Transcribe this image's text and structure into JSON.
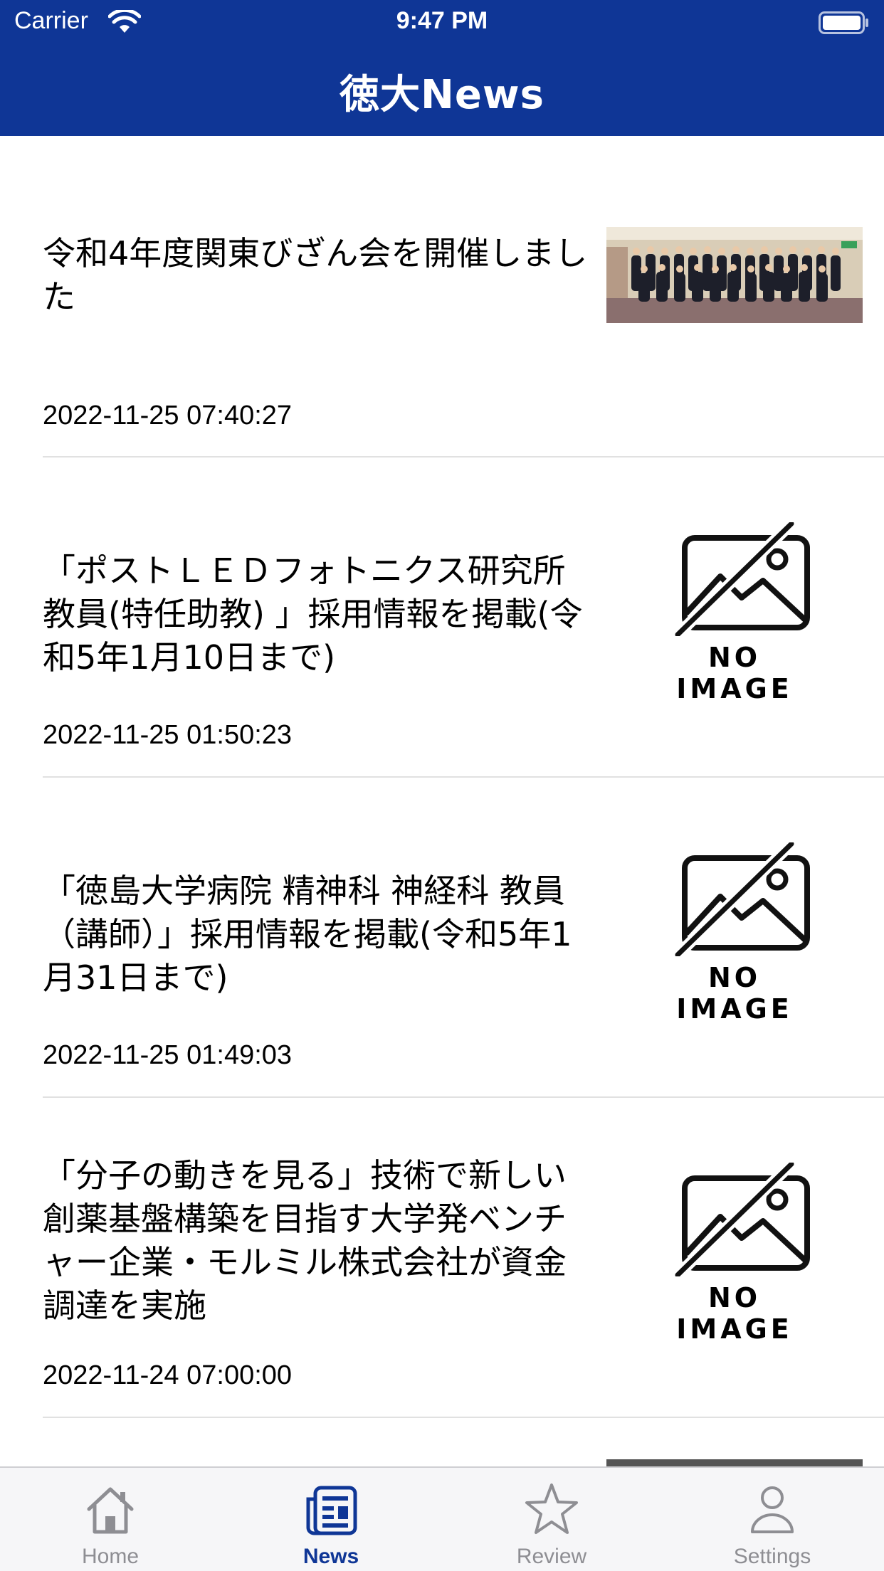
{
  "status_bar": {
    "carrier": "Carrier",
    "time": "9:47 PM"
  },
  "nav": {
    "title": "徳大News"
  },
  "news": [
    {
      "title": "令和4年度関東びざん会を開催しました",
      "date": "2022-11-25 07:40:27",
      "image": "photo"
    },
    {
      "title": "「ポストＬＥＤフォトニクス研究所 教員(特任助教) 」採用情報を掲載(令和5年1月10日まで)",
      "date": "2022-11-25 01:50:23",
      "image": "no-image"
    },
    {
      "title": "「徳島大学病院 精神科 神経科 教員（講師）」採用情報を掲載(令和5年1月31日まで)",
      "date": "2022-11-25 01:49:03",
      "image": "no-image"
    },
    {
      "title": "「分子の動きを見る」技術で新しい創薬基盤構築を目指す大学発ベンチャー企業・モルミル株式会社が資金調達を実施",
      "date": "2022-11-24 07:00:00",
      "image": "no-image"
    }
  ],
  "no_image_label": "NO IMAGE",
  "tabs": [
    {
      "label": "Home",
      "icon": "house-icon",
      "active": false
    },
    {
      "label": "News",
      "icon": "newspaper-icon",
      "active": true
    },
    {
      "label": "Review",
      "icon": "star-icon",
      "active": false
    },
    {
      "label": "Settings",
      "icon": "person-icon",
      "active": false
    }
  ],
  "colors": {
    "brand": "#0f3696",
    "tab_inactive": "#8e8e93"
  }
}
